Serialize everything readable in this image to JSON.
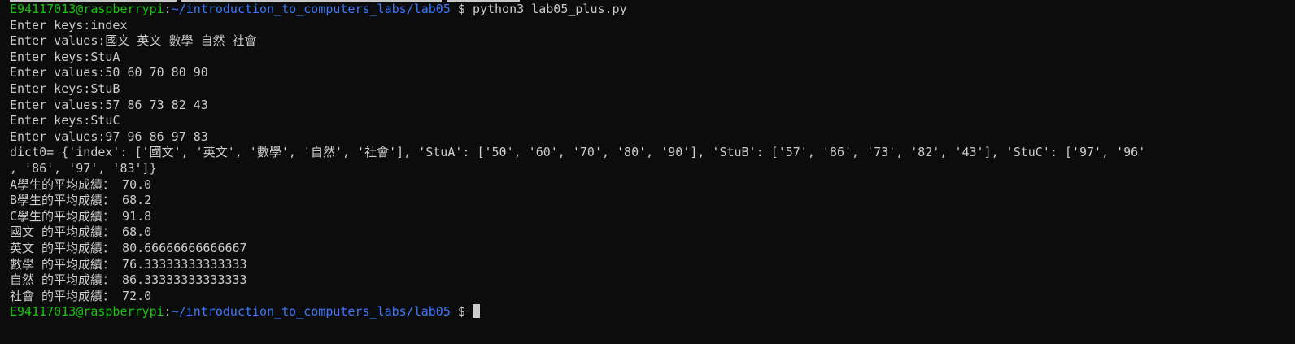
{
  "prompt": {
    "user_host": "E94117013@raspberrypi",
    "separator": ":",
    "path": "~/introduction_to_computers_labs/lab05",
    "symbol": " $ "
  },
  "command": "python3 lab05_plus.py",
  "output_lines": [
    "Enter keys:index",
    "Enter values:國文 英文 數學 自然 社會",
    "Enter keys:StuA",
    "Enter values:50 60 70 80 90",
    "Enter keys:StuB",
    "Enter values:57 86 73 82 43",
    "Enter keys:StuC",
    "Enter values:97 96 86 97 83",
    "dict0= {'index': ['國文', '英文', '數學', '自然', '社會'], 'StuA': ['50', '60', '70', '80', '90'], 'StuB': ['57', '86', '73', '82', '43'], 'StuC': ['97', '96'",
    ", '86', '97', '83']}",
    "A學生的平均成績： 70.0",
    "B學生的平均成績： 68.2",
    "C學生的平均成績： 91.8",
    "國文 的平均成績： 68.0",
    "英文 的平均成績： 80.66666666666667",
    "數學 的平均成績： 76.33333333333333",
    "自然 的平均成績： 86.33333333333333",
    "社會 的平均成績： 72.0"
  ],
  "colors": {
    "background": "#0c0c0c",
    "text": "#cccccc",
    "user_host": "#16c60c",
    "path": "#3b78ff"
  }
}
